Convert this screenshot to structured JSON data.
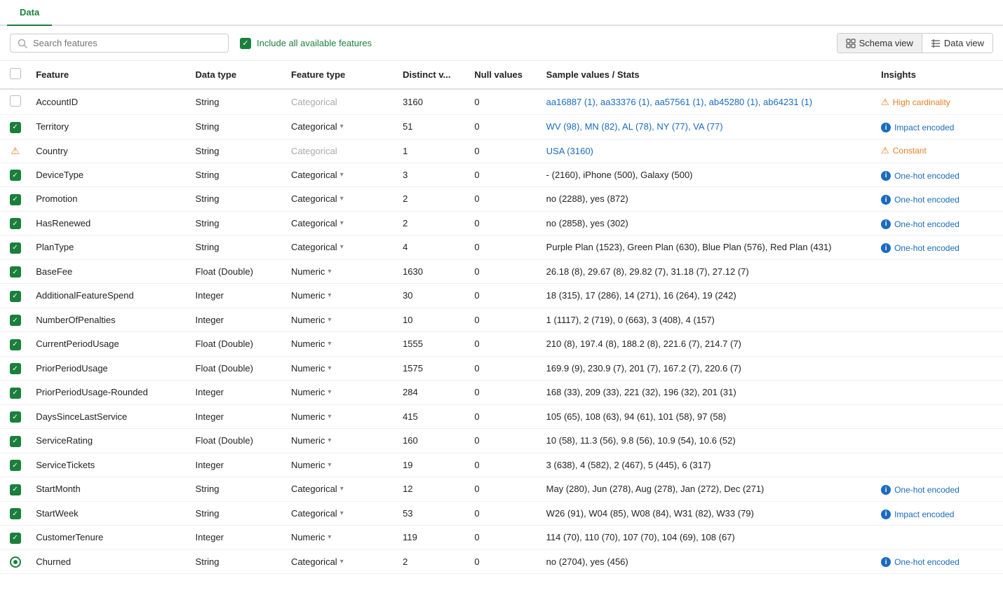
{
  "tabs": [
    {
      "id": "data",
      "label": "Data",
      "active": true
    }
  ],
  "toolbar": {
    "search_placeholder": "Search features",
    "include_label": "Include all available features",
    "schema_view_label": "Schema view",
    "data_view_label": "Data view"
  },
  "table": {
    "columns": [
      {
        "id": "check",
        "label": ""
      },
      {
        "id": "feature",
        "label": "Feature"
      },
      {
        "id": "datatype",
        "label": "Data type"
      },
      {
        "id": "featuretype",
        "label": "Feature type"
      },
      {
        "id": "distinct",
        "label": "Distinct v..."
      },
      {
        "id": "null",
        "label": "Null values"
      },
      {
        "id": "sample",
        "label": "Sample values / Stats"
      },
      {
        "id": "insights",
        "label": "Insights"
      }
    ],
    "rows": [
      {
        "check": "unchecked",
        "feature": "AccountID",
        "datatype": "String",
        "featuretype": "Categorical",
        "featuretype_disabled": true,
        "distinct": "3160",
        "null": "0",
        "sample": "aa16887 (1), aa33376 (1), aa57561 (1), ab45280 (1), ab64231 (1)",
        "sample_blue": true,
        "insight_type": "warning",
        "insight_text": "High cardinality"
      },
      {
        "check": "checked",
        "feature": "Territory",
        "datatype": "String",
        "featuretype": "Categorical",
        "featuretype_disabled": false,
        "distinct": "51",
        "null": "0",
        "sample": "WV (98), MN (82), AL (78), NY (77), VA (77)",
        "sample_blue": true,
        "insight_type": "info",
        "insight_text": "Impact encoded"
      },
      {
        "check": "warning",
        "feature": "Country",
        "datatype": "String",
        "featuretype": "Categorical",
        "featuretype_disabled": true,
        "distinct": "1",
        "null": "0",
        "sample": "USA (3160)",
        "sample_blue": true,
        "insight_type": "warning",
        "insight_text": "Constant"
      },
      {
        "check": "checked",
        "feature": "DeviceType",
        "datatype": "String",
        "featuretype": "Categorical",
        "featuretype_disabled": false,
        "distinct": "3",
        "null": "0",
        "sample": "- (2160), iPhone (500), Galaxy (500)",
        "sample_blue": false,
        "insight_type": "info",
        "insight_text": "One-hot encoded"
      },
      {
        "check": "checked",
        "feature": "Promotion",
        "datatype": "String",
        "featuretype": "Categorical",
        "featuretype_disabled": false,
        "distinct": "2",
        "null": "0",
        "sample": "no (2288), yes (872)",
        "sample_blue": false,
        "insight_type": "info",
        "insight_text": "One-hot encoded"
      },
      {
        "check": "checked",
        "feature": "HasRenewed",
        "datatype": "String",
        "featuretype": "Categorical",
        "featuretype_disabled": false,
        "distinct": "2",
        "null": "0",
        "sample": "no (2858), yes (302)",
        "sample_blue": false,
        "insight_type": "info",
        "insight_text": "One-hot encoded"
      },
      {
        "check": "checked",
        "feature": "PlanType",
        "datatype": "String",
        "featuretype": "Categorical",
        "featuretype_disabled": false,
        "distinct": "4",
        "null": "0",
        "sample": "Purple Plan (1523), Green Plan (630), Blue Plan (576), Red Plan (431)",
        "sample_blue": false,
        "insight_type": "info",
        "insight_text": "One-hot encoded"
      },
      {
        "check": "checked",
        "feature": "BaseFee",
        "datatype": "Float (Double)",
        "featuretype": "Numeric",
        "featuretype_disabled": false,
        "distinct": "1630",
        "null": "0",
        "sample": "26.18 (8), 29.67 (8), 29.82 (7), 31.18 (7), 27.12 (7)",
        "sample_blue": false,
        "insight_type": "none",
        "insight_text": ""
      },
      {
        "check": "checked",
        "feature": "AdditionalFeatureSpend",
        "datatype": "Integer",
        "featuretype": "Numeric",
        "featuretype_disabled": false,
        "distinct": "30",
        "null": "0",
        "sample": "18 (315), 17 (286), 14 (271), 16 (264), 19 (242)",
        "sample_blue": false,
        "insight_type": "none",
        "insight_text": ""
      },
      {
        "check": "checked",
        "feature": "NumberOfPenalties",
        "datatype": "Integer",
        "featuretype": "Numeric",
        "featuretype_disabled": false,
        "distinct": "10",
        "null": "0",
        "sample": "1 (1117), 2 (719), 0 (663), 3 (408), 4 (157)",
        "sample_blue": false,
        "insight_type": "none",
        "insight_text": ""
      },
      {
        "check": "checked",
        "feature": "CurrentPeriodUsage",
        "datatype": "Float (Double)",
        "featuretype": "Numeric",
        "featuretype_disabled": false,
        "distinct": "1555",
        "null": "0",
        "sample": "210 (8), 197.4 (8), 188.2 (8), 221.6 (7), 214.7 (7)",
        "sample_blue": false,
        "insight_type": "none",
        "insight_text": ""
      },
      {
        "check": "checked",
        "feature": "PriorPeriodUsage",
        "datatype": "Float (Double)",
        "featuretype": "Numeric",
        "featuretype_disabled": false,
        "distinct": "1575",
        "null": "0",
        "sample": "169.9 (9), 230.9 (7), 201 (7), 167.2 (7), 220.6 (7)",
        "sample_blue": false,
        "insight_type": "none",
        "insight_text": ""
      },
      {
        "check": "checked",
        "feature": "PriorPeriodUsage-Rounded",
        "datatype": "Integer",
        "featuretype": "Numeric",
        "featuretype_disabled": false,
        "distinct": "284",
        "null": "0",
        "sample": "168 (33), 209 (33), 221 (32), 196 (32), 201 (31)",
        "sample_blue": false,
        "insight_type": "none",
        "insight_text": ""
      },
      {
        "check": "checked",
        "feature": "DaysSinceLastService",
        "datatype": "Integer",
        "featuretype": "Numeric",
        "featuretype_disabled": false,
        "distinct": "415",
        "null": "0",
        "sample": "105 (65), 108 (63), 94 (61), 101 (58), 97 (58)",
        "sample_blue": false,
        "insight_type": "none",
        "insight_text": ""
      },
      {
        "check": "checked",
        "feature": "ServiceRating",
        "datatype": "Float (Double)",
        "featuretype": "Numeric",
        "featuretype_disabled": false,
        "distinct": "160",
        "null": "0",
        "sample": "10 (58), 11.3 (56), 9.8 (56), 10.9 (54), 10.6 (52)",
        "sample_blue": false,
        "insight_type": "none",
        "insight_text": ""
      },
      {
        "check": "checked",
        "feature": "ServiceTickets",
        "datatype": "Integer",
        "featuretype": "Numeric",
        "featuretype_disabled": false,
        "distinct": "19",
        "null": "0",
        "sample": "3 (638), 4 (582), 2 (467), 5 (445), 6 (317)",
        "sample_blue": false,
        "insight_type": "none",
        "insight_text": ""
      },
      {
        "check": "checked",
        "feature": "StartMonth",
        "datatype": "String",
        "featuretype": "Categorical",
        "featuretype_disabled": false,
        "distinct": "12",
        "null": "0",
        "sample": "May (280), Jun (278), Aug (278), Jan (272), Dec (271)",
        "sample_blue": false,
        "insight_type": "info",
        "insight_text": "One-hot encoded"
      },
      {
        "check": "checked",
        "feature": "StartWeek",
        "datatype": "String",
        "featuretype": "Categorical",
        "featuretype_disabled": false,
        "distinct": "53",
        "null": "0",
        "sample": "W26 (91), W04 (85), W08 (84), W31 (82), W33 (79)",
        "sample_blue": false,
        "insight_type": "info",
        "insight_text": "Impact encoded"
      },
      {
        "check": "checked",
        "feature": "CustomerTenure",
        "datatype": "Integer",
        "featuretype": "Numeric",
        "featuretype_disabled": false,
        "distinct": "119",
        "null": "0",
        "sample": "114 (70), 110 (70), 107 (70), 104 (69), 108 (67)",
        "sample_blue": false,
        "insight_type": "none",
        "insight_text": ""
      },
      {
        "check": "target",
        "feature": "Churned",
        "datatype": "String",
        "featuretype": "Categorical",
        "featuretype_disabled": false,
        "distinct": "2",
        "null": "0",
        "sample": "no (2704), yes (456)",
        "sample_blue": false,
        "insight_type": "info",
        "insight_text": "One-hot encoded"
      }
    ]
  }
}
